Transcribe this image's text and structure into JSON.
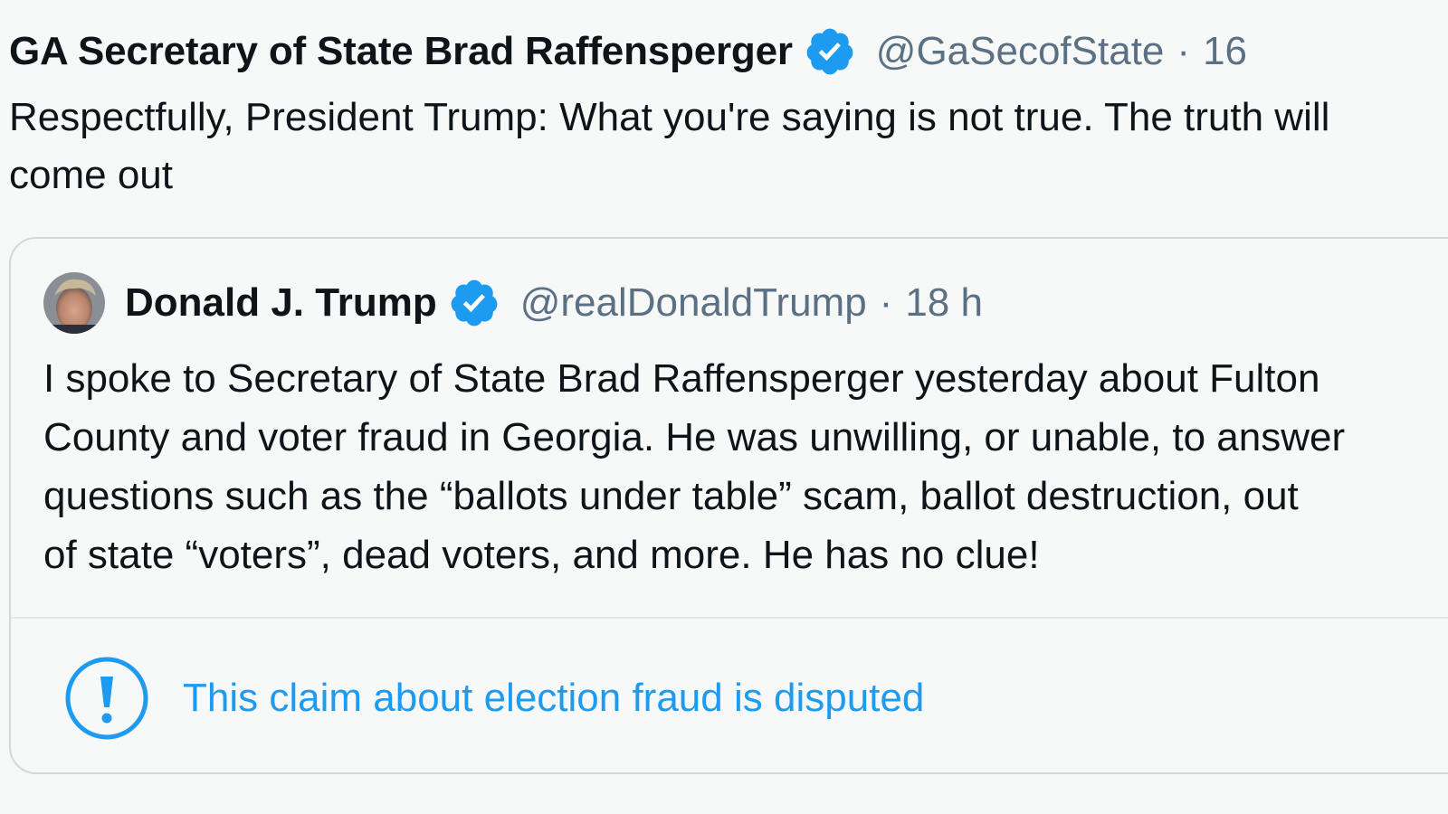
{
  "tweet": {
    "display_name": "GA Secretary of State Brad Raffensperger",
    "handle": "@GaSecofState",
    "separator": "·",
    "time": "16",
    "text_lines": [
      "Respectfully, President Trump: What you're saying is not true. The truth will",
      "come out"
    ]
  },
  "quoted_tweet": {
    "display_name": "Donald J. Trump",
    "handle": "@realDonaldTrump",
    "separator": "·",
    "time": "18 h",
    "text_lines": [
      "I spoke to Secretary of State Brad Raffensperger yesterday about Fulton",
      "County and voter fraud in Georgia. He was unwilling, or unable, to answer",
      "questions such as the “ballots under table” scam, ballot destruction, out",
      "of state “voters”, dead voters, and more. He has no clue!"
    ]
  },
  "notice": {
    "text": "This claim about election fraud is disputed",
    "icon": "exclamation-circle-icon"
  },
  "colors": {
    "background": "#f7f9f9",
    "text_primary": "#0f1419",
    "text_secondary": "#5b7083",
    "accent_blue": "#1d9bf0",
    "border": "#cfd9de"
  }
}
